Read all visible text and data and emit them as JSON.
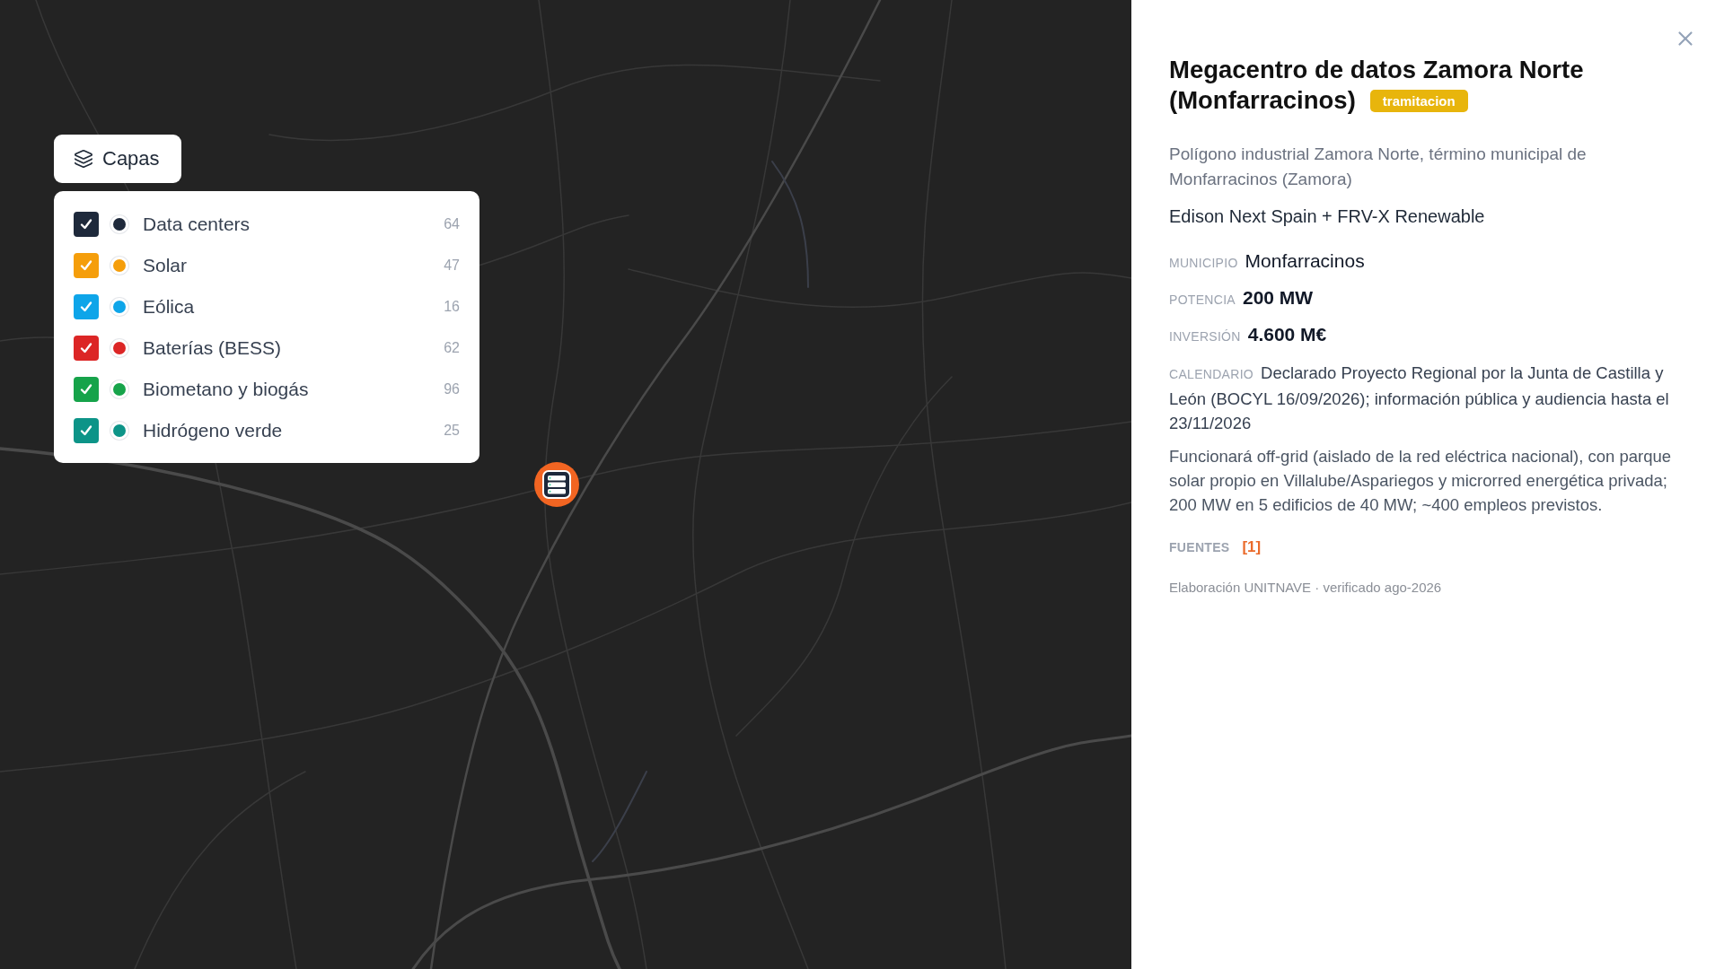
{
  "map": {
    "marker": {
      "kind": "data_center",
      "selected": true
    }
  },
  "layers": {
    "button_label": "Capas",
    "items": [
      {
        "label": "Data centers",
        "count": "64",
        "color": "#1e293b",
        "checked": true
      },
      {
        "label": "Solar",
        "count": "47",
        "color": "#f59e0b",
        "checked": true
      },
      {
        "label": "Eólica",
        "count": "16",
        "color": "#0ea5e9",
        "checked": true
      },
      {
        "label": "Baterías (BESS)",
        "count": "62",
        "color": "#dc2626",
        "checked": true
      },
      {
        "label": "Biometano y biogás",
        "count": "96",
        "color": "#16a34a",
        "checked": true
      },
      {
        "label": "Hidrógeno verde",
        "count": "25",
        "color": "#0d9488",
        "checked": true
      }
    ]
  },
  "detail": {
    "title": "Megacentro de datos Zamora Norte (Monfarracinos)",
    "status": "tramitacion",
    "location": "Polígono industrial Zamora Norte, término municipal de Monfarracinos (Zamora)",
    "promoter": "Edison Next Spain + FRV-X Renewable",
    "fields": [
      {
        "kind": "plain",
        "label": "MUNICIPIO",
        "value": "Monfarracinos"
      },
      {
        "kind": "bold",
        "label": "POTENCIA",
        "value": "200 MW"
      },
      {
        "kind": "bold",
        "label": "INVERSIÓN",
        "value": "4.600 M€"
      },
      {
        "kind": "text",
        "label": "CALENDARIO",
        "value": "Declarado Proyecto Regional por la Junta de Castilla y León (BOCYL 16/09/2026); información pública y audiencia hasta el 23/11/2026"
      }
    ],
    "description": "Funcionará off-grid (aislado de la red eléctrica nacional), con parque solar propio en Villalube/Aspariegos y microrred energética privada; 200 MW en 5 edificios de 40 MW; ~400 empleos previstos.",
    "sources": {
      "label": "FUENTES",
      "links": [
        "[1]"
      ]
    },
    "footer": "Elaboración UNITNAVE · verificado ago-2026"
  }
}
